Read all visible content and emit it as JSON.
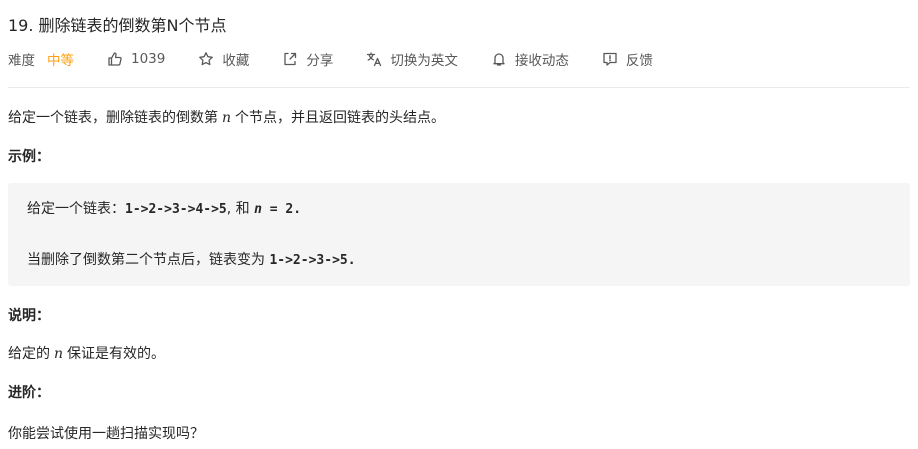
{
  "problem": {
    "title": "19. 删除链表的倒数第N个节点"
  },
  "toolbar": {
    "difficulty_label": "难度",
    "difficulty_value": "中等",
    "difficulty_color": "#ffa116",
    "like_count": "1039",
    "like_icon": "thumbs-up-icon",
    "favorite_label": "收藏",
    "favorite_icon": "star-icon",
    "share_label": "分享",
    "share_icon": "share-icon",
    "translate_label": "切换为英文",
    "translate_icon": "translate-icon",
    "notify_label": "接收动态",
    "notify_icon": "bell-icon",
    "feedback_label": "反馈",
    "feedback_icon": "feedback-icon"
  },
  "description": {
    "intro_before": "给定一个链表，删除链表的倒数第",
    "intro_var": "n",
    "intro_after": "个节点，并且返回链表的头结点。",
    "example_heading": "示例：",
    "example": {
      "line1_prefix": "给定一个链表：",
      "line1_list": "1->2->3->4->5",
      "line1_mid": ", 和 ",
      "line1_var": "n",
      "line1_value": " = 2",
      "line1_end": ".",
      "line2_prefix": "当删除了倒数第二个节点后，链表变为 ",
      "line2_list": "1->2->3->5",
      "line2_end": "."
    },
    "note_heading": "说明：",
    "note_before": "给定的",
    "note_var": "n",
    "note_after": "保证是有效的。",
    "advanced_heading": "进阶：",
    "advanced_text": "你能尝试使用一趟扫描实现吗？"
  }
}
